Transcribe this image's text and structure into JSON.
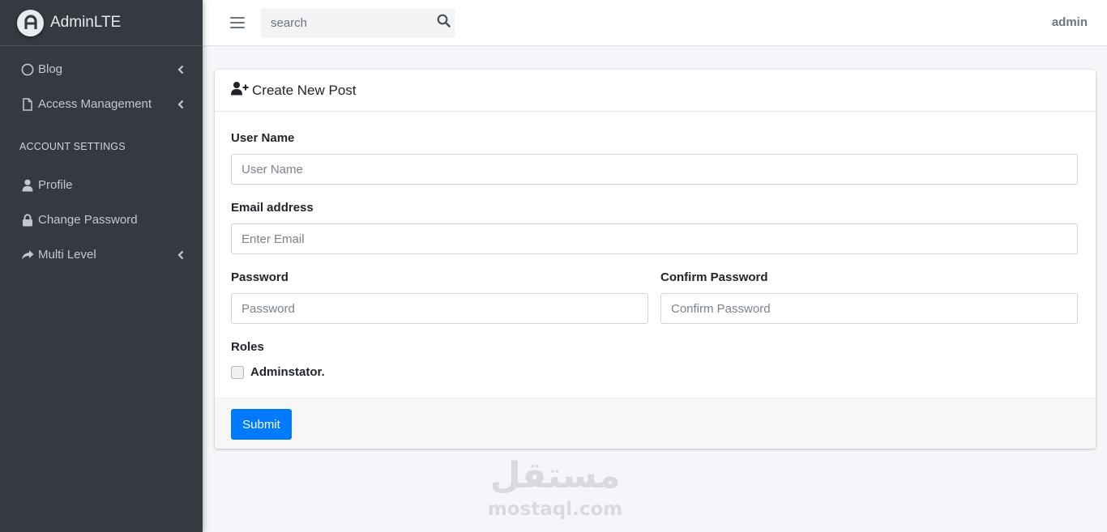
{
  "brand": {
    "name": "AdminLTE"
  },
  "sidebar": {
    "items": [
      {
        "label": "Blog",
        "icon": "circle-icon",
        "has_submenu": true
      },
      {
        "label": "Access Management",
        "icon": "file-icon",
        "has_submenu": true
      }
    ],
    "section_header": "ACCOUNT SETTINGS",
    "account_items": [
      {
        "label": "Profile",
        "icon": "user-icon",
        "has_submenu": false
      },
      {
        "label": "Change Password",
        "icon": "lock-icon",
        "has_submenu": false
      },
      {
        "label": "Multi Level",
        "icon": "share-icon",
        "has_submenu": true
      }
    ]
  },
  "topbar": {
    "search_placeholder": "search",
    "user_name": "admin"
  },
  "card": {
    "title": "Create New Post",
    "title_icon": "user-plus-icon",
    "fields": {
      "username": {
        "label": "User Name",
        "placeholder": "User Name",
        "value": ""
      },
      "email": {
        "label": "Email address",
        "placeholder": "Enter Email",
        "value": ""
      },
      "password": {
        "label": "Password",
        "placeholder": "Password",
        "value": ""
      },
      "confirm_password": {
        "label": "Confirm Password",
        "placeholder": "Confirm Password",
        "value": ""
      }
    },
    "roles": {
      "label": "Roles",
      "options": [
        {
          "label": "Adminstator.",
          "checked": false
        }
      ]
    },
    "submit_label": "Submit"
  },
  "watermark": {
    "arabic": "مستقل",
    "latin": "mostaql.com"
  },
  "colors": {
    "sidebar_bg": "#343a40",
    "primary": "#007bff",
    "page_bg": "#f4f6f9"
  }
}
